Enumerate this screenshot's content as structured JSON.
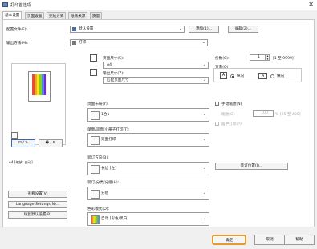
{
  "window": {
    "title": "打印首选项"
  },
  "tabs": [
    "基本设置",
    "页面设置",
    "完成方式",
    "纸张来源",
    "质量"
  ],
  "profile": {
    "label": "配置文件(F):",
    "value": "默认设置",
    "add_label": "添加(1)...",
    "edit_label": "编辑(2)..."
  },
  "output_method": {
    "label": "输出方法(M):",
    "value": "打印"
  },
  "preview": {
    "caption": "A4 [缩放: 自动]"
  },
  "left_buttons": [
    "查看设置(V)",
    "Language Settings(N)...",
    "恢复默认设置(R)"
  ],
  "page_size": {
    "label": "页面尺寸(S):",
    "value": "A4"
  },
  "output_size": {
    "label": "输出尺寸(Z):",
    "value": "匹配页面尺寸"
  },
  "copies": {
    "label": "份数(C):",
    "value": "1",
    "range": "[1 至 9999]"
  },
  "orientation": {
    "label": "方向(O)",
    "portrait": "纵向",
    "landscape": "横向",
    "selected": "portrait"
  },
  "page_layout": {
    "label": "页面布局(Y):",
    "value": "1合1"
  },
  "manual_scaling": {
    "label": "手动缩放(N)",
    "scale_label": "缩放(C):",
    "scale_value": "100",
    "scale_range": "% [25 至 400]",
    "print_center_label": "居中打印(P)"
  },
  "print_style": {
    "label": "单面/双面/小册子打印(T):",
    "value": "双面打印"
  },
  "binding": {
    "label": "装订方向(B):",
    "value": "长边 [左]",
    "location_button": "装订位置(I)..."
  },
  "collate": {
    "label": "装订/分类/分组(H):",
    "value": "分组"
  },
  "color_mode": {
    "label": "色彩模式(O):",
    "value": "自动 [彩色/黑白]"
  },
  "footer": {
    "ok": "确定",
    "cancel": "取消",
    "help": "帮助"
  },
  "colors": {
    "accent": "#e59a2b"
  }
}
